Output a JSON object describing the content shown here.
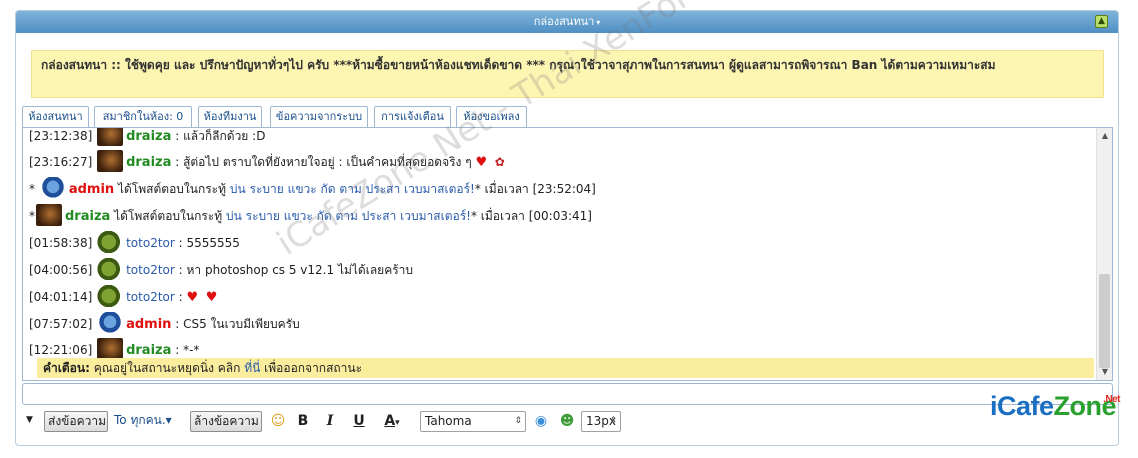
{
  "panel": {
    "title": "กล่องสนทนา",
    "title_chevron": "▾",
    "collapse_icon": "▲"
  },
  "notice": "กล่องสนทนา :: ใช้พูดคุย และ ปรึกษาปัญหาทั่วๆไป ครับ ***ห้ามซื้อขายหน้าห้องแชทเด็ดขาด *** กรุณาใช้วาจาสุภาพในการสนทนา ผู้ดูแลสามารถพิจารณา Ban ได้ตามความเหมาะสม",
  "tabs": [
    {
      "label": "ห้องสนทนา"
    },
    {
      "label": "สมาชิกในห้อง: 0"
    },
    {
      "label": "ห้องทีมงาน"
    },
    {
      "label": "ข้อความจากระบบ"
    },
    {
      "label": "การแจ้งเตือน"
    },
    {
      "label": "ห้องขอเพลง"
    }
  ],
  "messages": {
    "m1": {
      "ts": "[23:12:38]",
      "user": "draiza",
      "text": " : แล้วก็ลีกด้วย :D"
    },
    "m2": {
      "ts": "[23:16:27]",
      "user": "draiza",
      "text": " : สู้ต่อไป ตราบใดที่ยังหายใจอยู่ : เป็นคำคมที่สุดยอดจริง ๆ "
    },
    "m3": {
      "prefix": "*",
      "user": "admin",
      "text1": " ได้โพสต์ตอบในกระทู้ ",
      "link": "บ่น ระบาย แขวะ กัด ตาม ประสา เวบมาสเตอร์!",
      "text2": "* เมื่อเวลา [23:52:04]"
    },
    "m4": {
      "prefix": "*",
      "user": "draiza",
      "text1": " ได้โพสต์ตอบในกระทู้ ",
      "link": "บ่น ระบาย แขวะ กัด ตาม ประสา เวบมาสเตอร์!",
      "text2": "* เมื่อเวลา [00:03:41]"
    },
    "m5": {
      "ts": "[01:58:38]",
      "user": "toto2tor",
      "text": " : 5555555"
    },
    "m6": {
      "ts": "[04:00:56]",
      "user": "toto2tor",
      "text": " : หา photoshop cs 5 v12.1 ไม่ได้เลยคร้าบ"
    },
    "m7": {
      "ts": "[04:01:14]",
      "user": "toto2tor",
      "text": " : "
    },
    "m8": {
      "ts": "[07:57:02]",
      "user": "admin",
      "text": " : CS5 ในเวบมีเพียบครับ"
    },
    "m9": {
      "ts": "[12:21:06]",
      "user": "draiza",
      "text": " : *-*"
    }
  },
  "emoji": {
    "heart": "♥",
    "flower": "✿"
  },
  "warning": {
    "label": "คำเตือน:",
    "text1": " คุณอยู่ในสถานะหยุดนิ่ง คลิก ",
    "link": "ที่นี่",
    "text2": " เพื่อออกจากสถานะ"
  },
  "scroll": {
    "up": "▲",
    "down": "▼"
  },
  "toolbar": {
    "menu_arrow": "▼",
    "send_label": "ส่งข้อความ",
    "to_label": "To ทุกคน.",
    "to_arrow": "▾",
    "clear_label": "ล้างข้อความ",
    "smile_icon": "☺",
    "bold": "B",
    "italic": "I",
    "underline": "U",
    "color": "A",
    "color_arrow": "▾",
    "font_value": "Tahoma",
    "select_arrow": "⇕",
    "bubble_icon": "◉",
    "user_icon": "☻",
    "size_value": "13px"
  },
  "logo": {
    "part1": "iCafe",
    "part2": "Zone",
    "net": ".Net"
  },
  "watermark": "iCafeZone.Net - Thai XenForo Community",
  "colors": {
    "accent_blue": "#4f8fc4",
    "name_green": "#228b22",
    "name_red": "#e01010",
    "notice_bg": "#fdf6b3"
  }
}
